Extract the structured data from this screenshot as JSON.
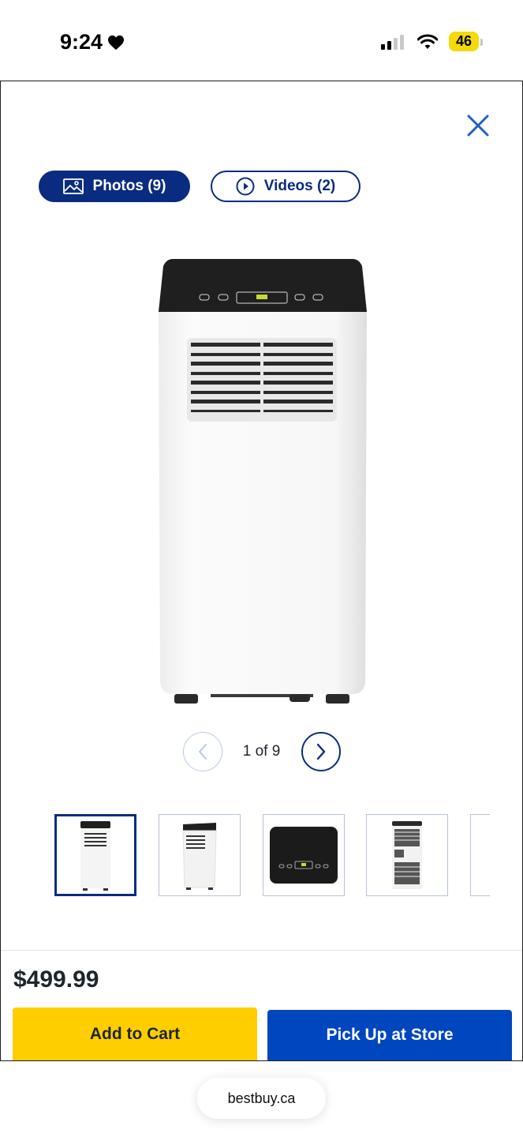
{
  "status_bar": {
    "time": "9:24",
    "battery": "46"
  },
  "modal": {
    "tabs": [
      {
        "label": "Photos (9)",
        "icon": "image-icon",
        "active": true
      },
      {
        "label": "Videos (2)",
        "icon": "play-circle-icon",
        "active": false
      }
    ],
    "pager": {
      "text": "1 of 9"
    },
    "thumbnails": [
      {
        "name": "front-view",
        "selected": true
      },
      {
        "name": "angle-view",
        "selected": false
      },
      {
        "name": "control-panel-view",
        "selected": false
      },
      {
        "name": "rear-view",
        "selected": false
      },
      {
        "name": "more",
        "selected": false
      }
    ],
    "price": "$499.99",
    "add_to_cart_label": "Add to Cart",
    "pickup_label": "Pick Up at Store"
  },
  "browser": {
    "url": "bestbuy.ca"
  },
  "colors": {
    "brand_blue": "#0046be",
    "navy": "#0a2c80",
    "yellow": "#ffce00"
  }
}
